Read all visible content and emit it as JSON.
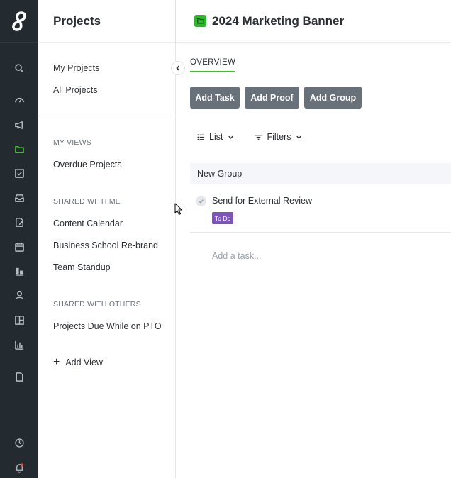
{
  "sidebar": {
    "title": "Projects",
    "links": [
      "My Projects",
      "All Projects"
    ],
    "my_views": {
      "heading": "MY VIEWS",
      "items": [
        "Overdue Projects"
      ]
    },
    "shared_with_me": {
      "heading": "SHARED WITH ME",
      "items": [
        "Content Calendar",
        "Business School Re-brand",
        "Team Standup"
      ]
    },
    "shared_with_others": {
      "heading": "SHARED WITH OTHERS",
      "items": [
        "Projects Due While on PTO"
      ]
    },
    "add_view": "Add View"
  },
  "rail": {
    "icons": [
      "search-icon",
      "dashboard-icon",
      "megaphone-icon",
      "folder-icon",
      "checkbox-icon",
      "inbox-icon",
      "proof-icon",
      "calendar-icon",
      "resources-icon",
      "user-icon",
      "layout-icon",
      "reports-icon",
      "document-icon",
      "clock-icon",
      "bell-icon"
    ],
    "active": "folder-icon"
  },
  "main": {
    "title": "2024 Marketing Banner",
    "tab": "OVERVIEW",
    "buttons": {
      "add_task": "Add Task",
      "add_proof": "Add Proof",
      "add_group": "Add Group"
    },
    "toolbar": {
      "list": "List",
      "filters": "Filters"
    },
    "group_name": "New Group",
    "task": {
      "name": "Send for External Review",
      "status": "To Do"
    },
    "add_task_placeholder": "Add a task..."
  },
  "colors": {
    "rail_bg": "#232a30",
    "accent_green": "#3fbf2f",
    "button_bg": "#687079",
    "status_todo": "#7b56b8"
  }
}
